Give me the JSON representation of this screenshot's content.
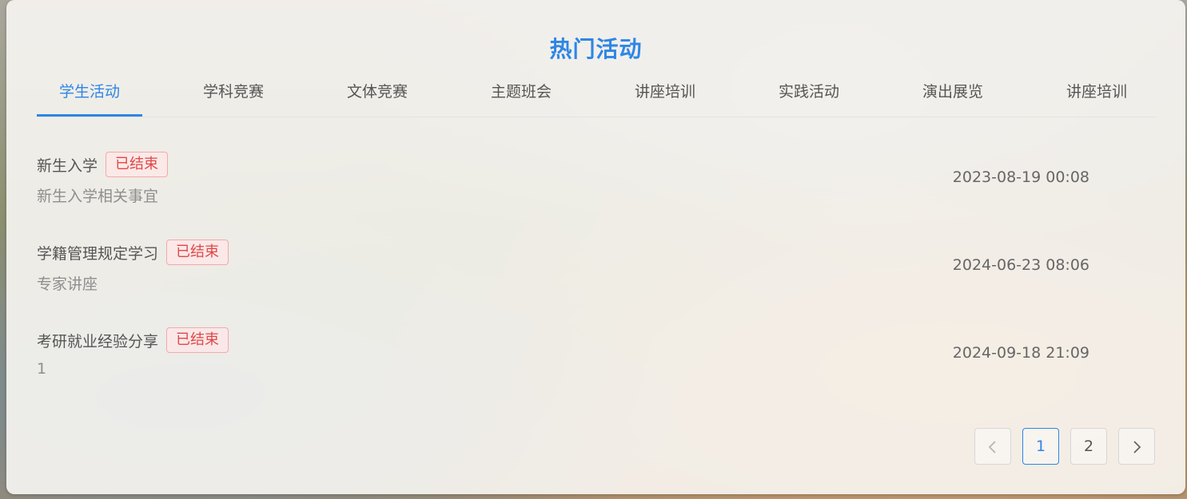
{
  "panel": {
    "title": "热门活动"
  },
  "tabs": [
    {
      "label": "学生活动",
      "active": true
    },
    {
      "label": "学科竞赛",
      "active": false
    },
    {
      "label": "文体竞赛",
      "active": false
    },
    {
      "label": "主题班会",
      "active": false
    },
    {
      "label": "讲座培训",
      "active": false
    },
    {
      "label": "实践活动",
      "active": false
    },
    {
      "label": "演出展览",
      "active": false
    },
    {
      "label": "讲座培训",
      "active": false
    }
  ],
  "activities": [
    {
      "title": "新生入学",
      "status": "已结束",
      "description": "新生入学相关事宜",
      "datetime": "2023-08-19 00:08"
    },
    {
      "title": "学籍管理规定学习",
      "status": "已结束",
      "description": "专家讲座",
      "datetime": "2024-06-23 08:06"
    },
    {
      "title": "考研就业经验分享",
      "status": "已结束",
      "description": "1",
      "datetime": "2024-09-18 21:09"
    }
  ],
  "pagination": {
    "prev_icon": "chevron-left-icon",
    "next_icon": "chevron-right-icon",
    "pages": [
      "1",
      "2"
    ],
    "current_page": "1"
  },
  "colors": {
    "accent": "#2e86e6",
    "status_text": "#e04848",
    "status_border": "#f4a9a9"
  }
}
